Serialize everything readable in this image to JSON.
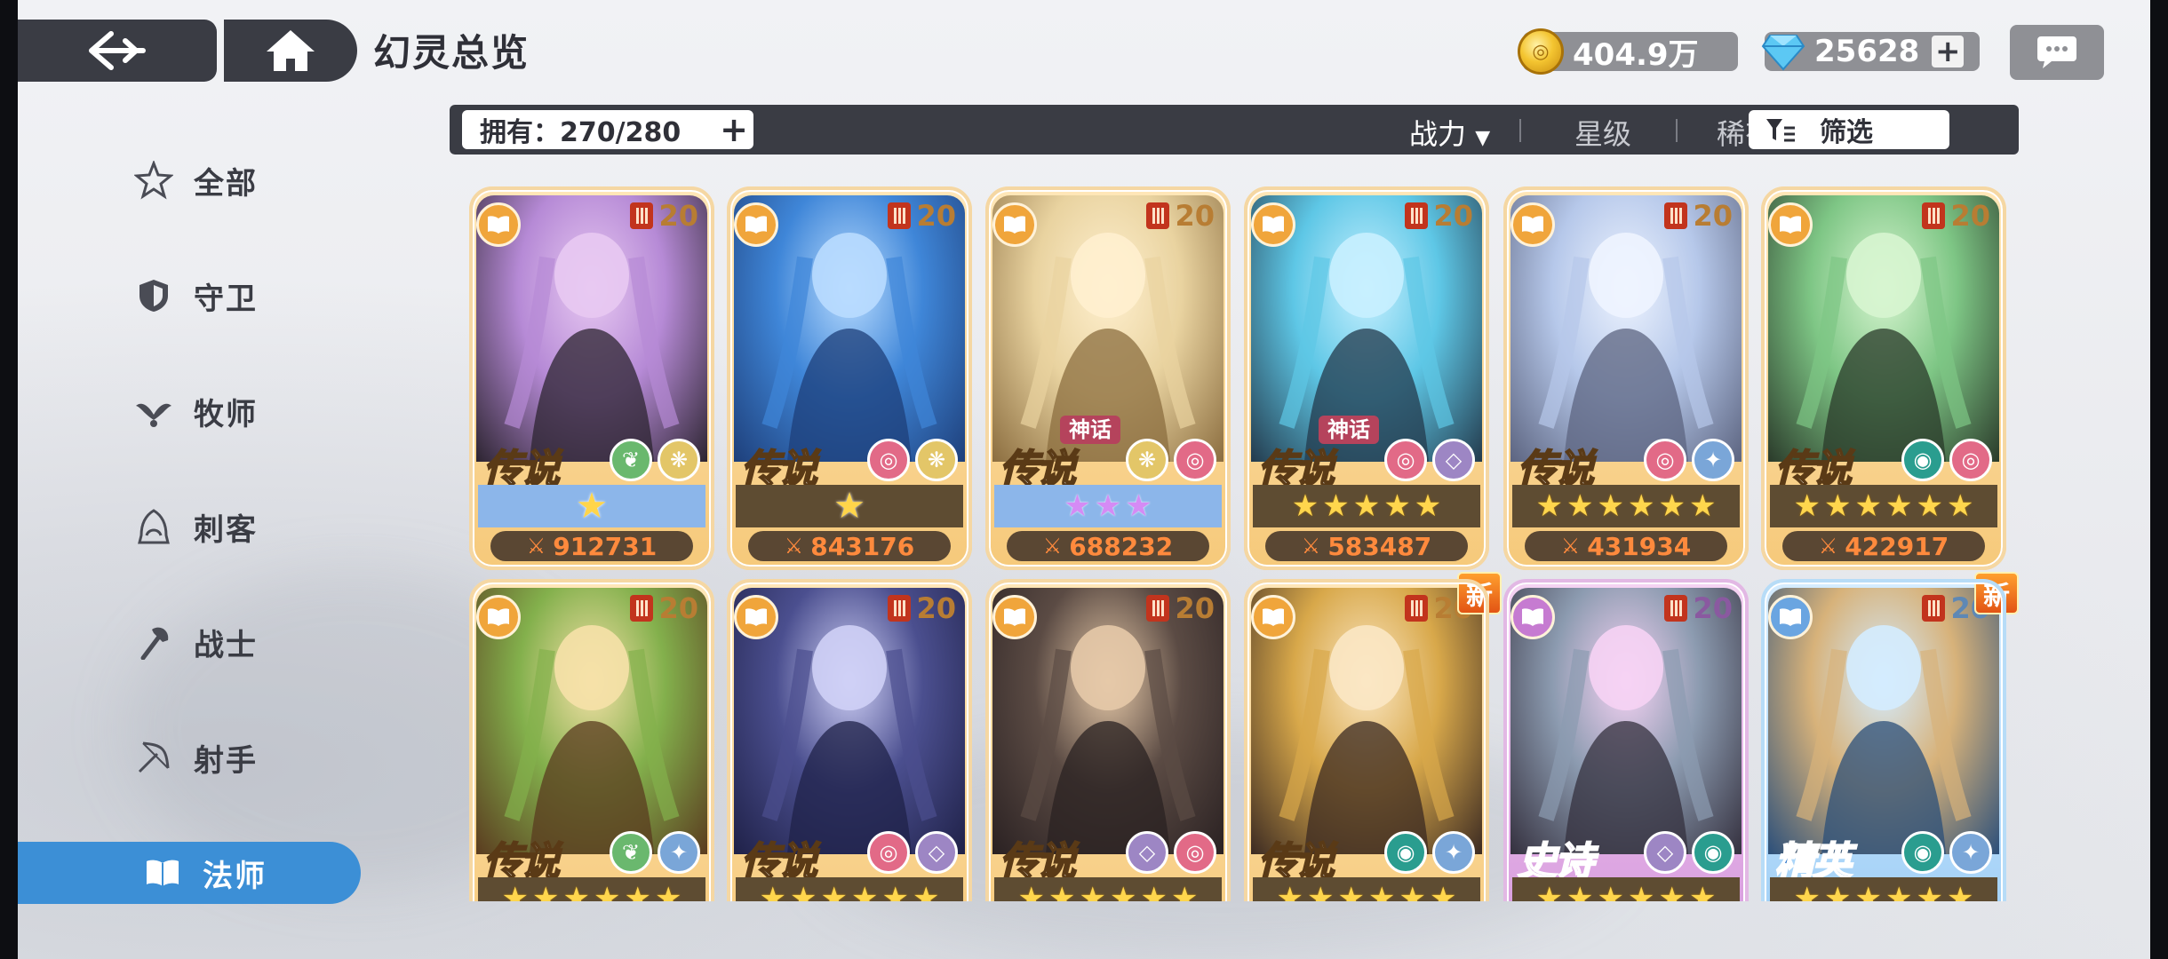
{
  "header": {
    "title": "幻灵总览",
    "coins": "404.9万",
    "gems": "25628"
  },
  "sidebar": {
    "items": [
      {
        "label": "全部",
        "icon": "star-outline-icon",
        "active": false
      },
      {
        "label": "守卫",
        "icon": "shield-icon",
        "active": false
      },
      {
        "label": "牧师",
        "icon": "wings-icon",
        "active": false
      },
      {
        "label": "刺客",
        "icon": "hood-icon",
        "active": false
      },
      {
        "label": "战士",
        "icon": "axe-icon",
        "active": false
      },
      {
        "label": "射手",
        "icon": "bow-icon",
        "active": false
      },
      {
        "label": "法师",
        "icon": "book-icon",
        "active": true
      }
    ]
  },
  "filter_bar": {
    "owned": "拥有：270/280",
    "sort_power": "战力",
    "sort_stars": "星级",
    "sort_rarity": "稀有度",
    "filter": "筛选"
  },
  "colors": {
    "accent_blue": "#3c8fd6",
    "dark_panel": "#3a3c44",
    "power_orange": "#ff8a3d",
    "legend_gold": "#f6c97a",
    "epic_purple": "#d597dc",
    "elite_blue": "#9ccdf5"
  },
  "cards": [
    {
      "rarity": "传说",
      "level": "20",
      "power": "912731",
      "stars": "crown",
      "band": "blue",
      "elements": [
        "leaf",
        "wing"
      ],
      "mythic": "",
      "new": "",
      "tier": "gold"
    },
    {
      "rarity": "传说",
      "level": "20",
      "power": "843176",
      "stars": "crown",
      "band": "gold",
      "elements": [
        "swirl",
        "wing"
      ],
      "mythic": "",
      "new": "",
      "tier": "gold"
    },
    {
      "rarity": "传说",
      "level": "20",
      "power": "688232",
      "stars": "purple3",
      "band": "blue",
      "elements": [
        "wing",
        "swirl"
      ],
      "mythic": "神话",
      "new": "",
      "tier": "gold"
    },
    {
      "rarity": "传说",
      "level": "20",
      "power": "583487",
      "stars": "yellow5",
      "band": "gold",
      "elements": [
        "swirl",
        "diamond"
      ],
      "mythic": "神话",
      "new": "",
      "tier": "gold"
    },
    {
      "rarity": "传说",
      "level": "20",
      "power": "431934",
      "stars": "yellow6",
      "band": "gold",
      "elements": [
        "swirl",
        "star"
      ],
      "mythic": "",
      "new": "",
      "tier": "gold"
    },
    {
      "rarity": "传说",
      "level": "20",
      "power": "422917",
      "stars": "yellow6",
      "band": "gold",
      "elements": [
        "eye",
        "swirl"
      ],
      "mythic": "",
      "new": "",
      "tier": "gold"
    },
    {
      "rarity": "传说",
      "level": "20",
      "power": "",
      "stars": "yellow6",
      "band": "gold",
      "elements": [
        "leaf",
        "star"
      ],
      "mythic": "",
      "new": "",
      "tier": "gold"
    },
    {
      "rarity": "传说",
      "level": "20",
      "power": "",
      "stars": "yellow6",
      "band": "gold",
      "elements": [
        "swirl",
        "diamond"
      ],
      "mythic": "",
      "new": "",
      "tier": "gold"
    },
    {
      "rarity": "传说",
      "level": "20",
      "power": "",
      "stars": "yellow6",
      "band": "gold",
      "elements": [
        "diamond",
        "swirl"
      ],
      "mythic": "",
      "new": "",
      "tier": "gold"
    },
    {
      "rarity": "传说",
      "level": "20",
      "power": "",
      "stars": "yellow6",
      "band": "gold",
      "elements": [
        "eye",
        "star"
      ],
      "mythic": "",
      "new": "新",
      "tier": "gold"
    },
    {
      "rarity": "史诗",
      "level": "20",
      "power": "",
      "stars": "yellow6",
      "band": "gold",
      "elements": [
        "diamond",
        "eye"
      ],
      "mythic": "",
      "new": "",
      "tier": "purple"
    },
    {
      "rarity": "精英",
      "level": "20",
      "power": "",
      "stars": "yellow6",
      "band": "gold",
      "elements": [
        "eye",
        "star"
      ],
      "mythic": "",
      "new": "新",
      "tier": "blue"
    }
  ]
}
